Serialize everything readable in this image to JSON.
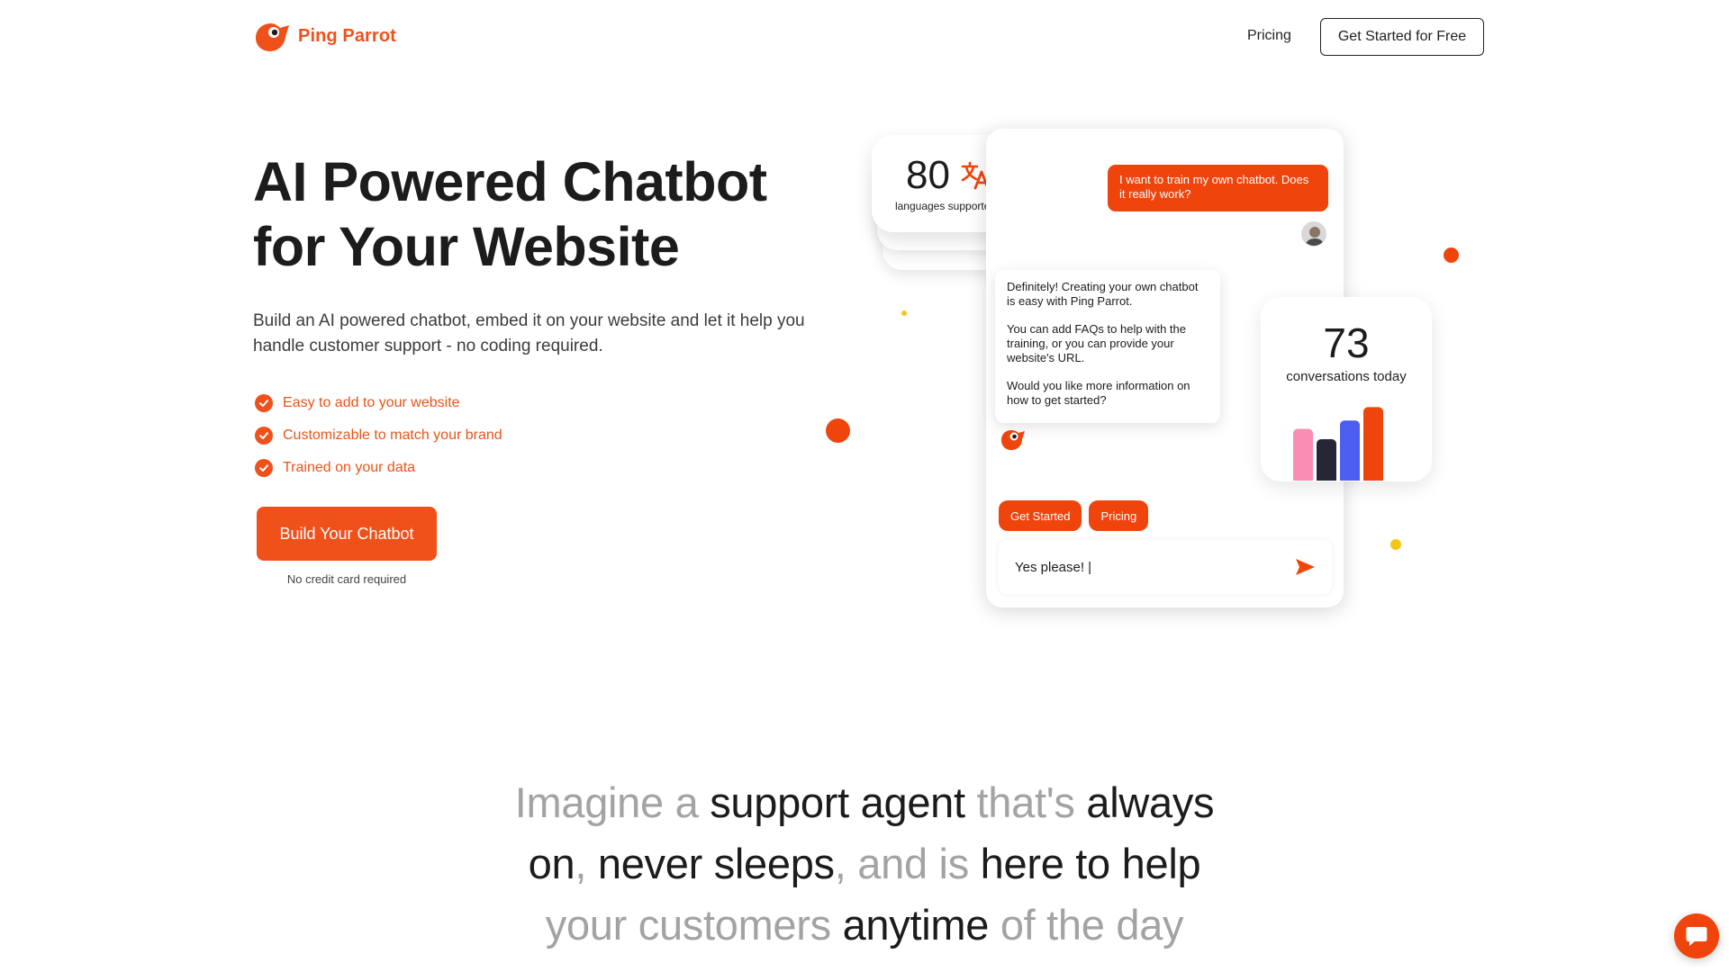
{
  "header": {
    "brand": "Ping Parrot",
    "nav_pricing": "Pricing",
    "cta": "Get Started for Free"
  },
  "hero": {
    "title_line1": "AI Powered Chatbot",
    "title_line2": "for Your Website",
    "subtitle": "Build an AI powered chatbot, embed it on your website and let it help you handle customer support - no coding required.",
    "features": [
      "Easy to add to your website",
      "Customizable to match your brand",
      "Trained on your data"
    ],
    "cta_button": "Build Your Chatbot",
    "cta_note": "No credit card required"
  },
  "languages_card": {
    "number": "80",
    "label": "languages supported",
    "icon": "translate-icon"
  },
  "chat": {
    "user_message": "I want to train my own chatbot. Does it really work?",
    "bot_paragraphs": [
      "Definitely! Creating your own chatbot is easy with Ping Parrot.",
      "You can add FAQs to help with the training, or you can provide your website's URL.",
      "Would you like more information on how to get started?"
    ],
    "quick_replies": [
      "Get Started",
      "Pricing"
    ],
    "input_value": "Yes please! |"
  },
  "conversations_card": {
    "number": "73",
    "label": "conversations today",
    "bars": [
      {
        "value": 50,
        "color": "#f98db4"
      },
      {
        "value": 40,
        "color": "#262637"
      },
      {
        "value": 58,
        "color": "#4b5ef0"
      },
      {
        "value": 71,
        "color": "#f0440d"
      }
    ]
  },
  "imagine": {
    "parts": [
      {
        "text": "Imagine a ",
        "style": "muted"
      },
      {
        "text": "support agent",
        "style": "strong"
      },
      {
        "text": " that's ",
        "style": "muted"
      },
      {
        "text": "always on",
        "style": "strong"
      },
      {
        "text": ", ",
        "style": "muted"
      },
      {
        "text": "never sleeps",
        "style": "strong"
      },
      {
        "text": ", and is ",
        "style": "muted"
      },
      {
        "text": "here to help",
        "style": "strong"
      },
      {
        "text": " your customers ",
        "style": "muted"
      },
      {
        "text": "anytime",
        "style": "strong"
      },
      {
        "text": " of the day",
        "style": "muted"
      }
    ]
  },
  "colors": {
    "brand": "#f0511b",
    "accent_yellow": "#f5c518"
  }
}
